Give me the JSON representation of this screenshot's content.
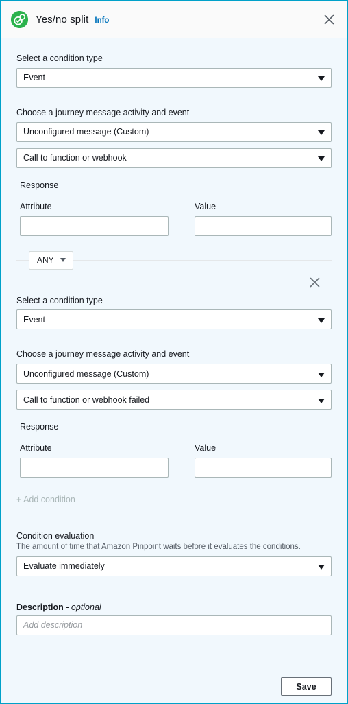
{
  "header": {
    "icon": "yes-no-split-icon",
    "title": "Yes/no split",
    "info_label": "Info",
    "close_label": "×",
    "icon_color": "#2bb24c",
    "link_color": "#0073bb"
  },
  "conditions": [
    {
      "condition_type_label": "Select a condition type",
      "condition_type_value": "Event",
      "activity_label": "Choose a journey message activity and event",
      "activity_value": "Unconfigured message (Custom)",
      "event_value": "Call to function or webhook",
      "response_label": "Response",
      "attribute_label": "Attribute",
      "attribute_value": "",
      "value_label": "Value",
      "value_value": ""
    },
    {
      "condition_type_label": "Select a condition type",
      "condition_type_value": "Event",
      "activity_label": "Choose a journey message activity and event",
      "activity_value": "Unconfigured message (Custom)",
      "event_value": "Call to function or webhook failed",
      "response_label": "Response",
      "attribute_label": "Attribute",
      "attribute_value": "",
      "value_label": "Value",
      "value_value": ""
    }
  ],
  "operator": {
    "value": "ANY"
  },
  "add_condition": {
    "label": "+ Add condition"
  },
  "condition_evaluation": {
    "title": "Condition evaluation",
    "description": "The amount of time that Amazon Pinpoint waits before it evaluates the conditions.",
    "value": "Evaluate immediately"
  },
  "description": {
    "label_main": "Description",
    "label_optional": "- optional",
    "value": "",
    "placeholder": "Add description"
  },
  "footer": {
    "save_label": "Save"
  }
}
